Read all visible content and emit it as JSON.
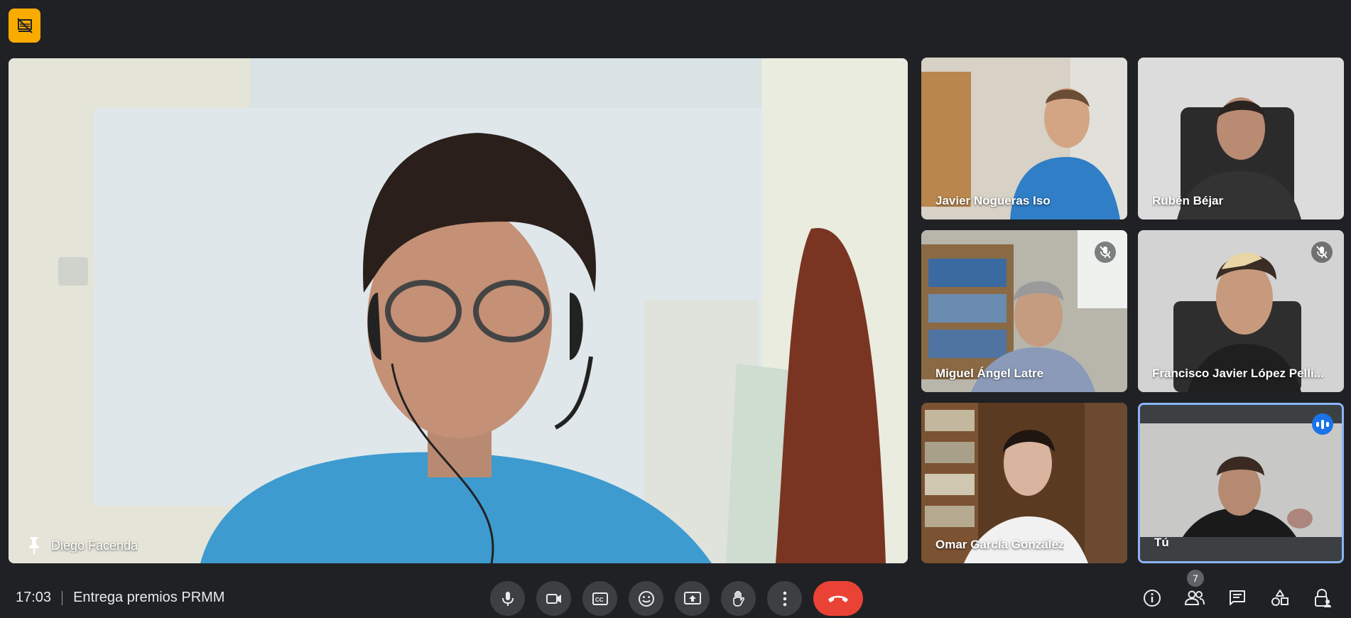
{
  "meeting": {
    "time": "17:03",
    "title": "Entrega premios PRMM"
  },
  "main_speaker": {
    "name": "Diego Facenda",
    "pinned": true
  },
  "participants": [
    {
      "name": "Javier Nogueras Iso",
      "muted": false
    },
    {
      "name": "Rubén Béjar",
      "muted": false
    },
    {
      "name": "Miguel Ángel Latre",
      "muted": true
    },
    {
      "name": "Francisco Javier López Pelli...",
      "muted": true
    },
    {
      "name": "Omar García González",
      "muted": false
    },
    {
      "name": "Tú",
      "muted": false,
      "speaking": true
    }
  ],
  "controls": [
    {
      "id": "mic",
      "icon": "microphone-icon"
    },
    {
      "id": "camera",
      "icon": "video-camera-icon"
    },
    {
      "id": "captions",
      "icon": "closed-captions-icon"
    },
    {
      "id": "emoji",
      "icon": "emoji-icon"
    },
    {
      "id": "present",
      "icon": "present-screen-icon"
    },
    {
      "id": "hand",
      "icon": "raise-hand-icon"
    },
    {
      "id": "more",
      "icon": "more-options-icon"
    },
    {
      "id": "hangup",
      "icon": "hang-up-icon"
    }
  ],
  "right_actions": {
    "participants_count": "7"
  },
  "colors": {
    "background": "#202124",
    "control_bg": "#3c4043",
    "hangup": "#ea4335",
    "badge": "#f9ab00",
    "speaking": "#1a73e8"
  }
}
